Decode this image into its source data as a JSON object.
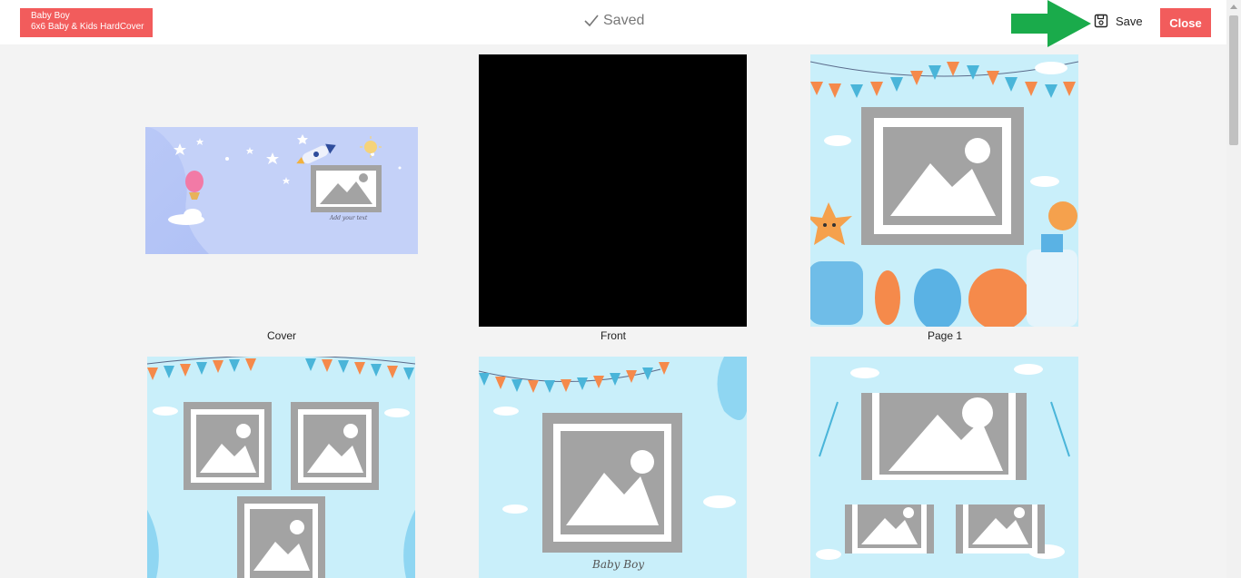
{
  "project": {
    "name": "Baby Boy",
    "product": "6x6 Baby & Kids HardCover"
  },
  "status": {
    "saved_label": "Saved"
  },
  "toolbar": {
    "save_label": "Save",
    "close_label": "Close"
  },
  "pages": {
    "cover_label": "Cover",
    "front_label": "Front",
    "page1_label": "Page 1",
    "cover_caption": "Add your text",
    "page3_caption": "Baby Boy"
  },
  "colors": {
    "accent": "#f25c5c",
    "arrow": "#1aab4b",
    "tile_bg": "#c9effa"
  }
}
